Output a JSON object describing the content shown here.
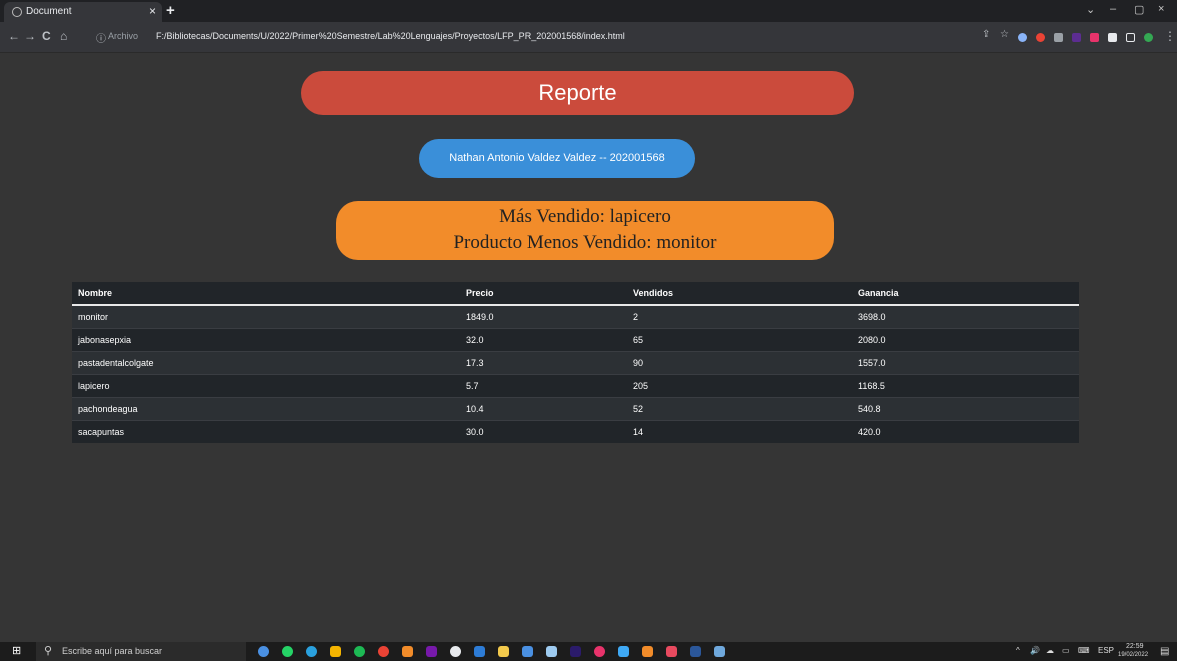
{
  "browser": {
    "tab_title": "Document",
    "tab_close": "×",
    "new_tab": "+",
    "nav": {
      "back": "←",
      "forward": "→",
      "reload": "C",
      "home": "⌂"
    },
    "address_label": "Archivo",
    "url": "F:/Bibliotecas/Documents/U/2022/Primer%20Semestre/Lab%20Lenguajes/Proyectos/LFP_PR_202001568/index.html",
    "window": {
      "chevron": "⌄",
      "minimize": "–",
      "restore": "▢",
      "close": "×"
    }
  },
  "page": {
    "title": "Reporte",
    "author": "Nathan Antonio Valdez Valdez -- 202001568",
    "best_seller": "Más Vendido: lapicero",
    "least_seller": "Producto Menos Vendido: monitor",
    "table": {
      "headers": [
        "Nombre",
        "Precio",
        "Vendidos",
        "Ganancia"
      ],
      "rows": [
        [
          "monitor",
          "1849.0",
          "2",
          "3698.0"
        ],
        [
          "jabonasepxia",
          "32.0",
          "65",
          "2080.0"
        ],
        [
          "pastadentalcolgate",
          "17.3",
          "90",
          "1557.0"
        ],
        [
          "lapicero",
          "5.7",
          "205",
          "1168.5"
        ],
        [
          "pachondeagua",
          "10.4",
          "52",
          "540.8"
        ],
        [
          "sacapuntas",
          "30.0",
          "14",
          "420.0"
        ]
      ]
    }
  },
  "taskbar": {
    "search_placeholder": "Escribe aquí para buscar",
    "language": "ESP",
    "time": "22:59",
    "date": "19/02/2022"
  },
  "colors": {
    "banner": "#cb4b3c",
    "author_pill": "#3a8fd9",
    "summary_pill": "#f28c2a",
    "background": "#353535"
  }
}
